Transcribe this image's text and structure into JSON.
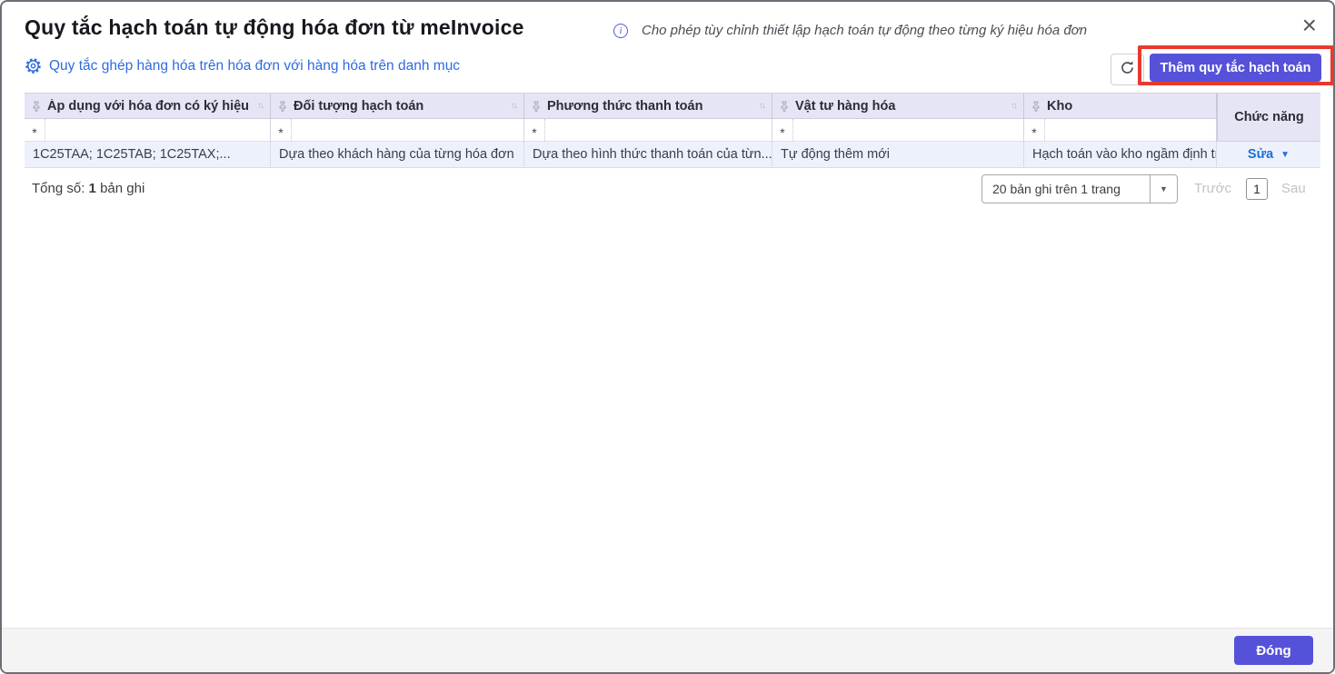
{
  "dialog": {
    "title": "Quy tắc hạch toán tự động hóa đơn từ meInvoice",
    "subtitle": "Cho phép tùy chỉnh thiết lập hạch toán tự động theo từng ký hiệu hóa đơn"
  },
  "toolbar": {
    "mapping_rule_link": "Quy tắc ghép hàng hóa trên hóa đơn với hàng hóa trên danh mục",
    "add_rule_button": "Thêm quy tắc hạch toán"
  },
  "table": {
    "columns": [
      {
        "label": "Áp dụng với hóa đơn có ký hiệu"
      },
      {
        "label": "Đối tượng hạch toán"
      },
      {
        "label": "Phương thức thanh toán"
      },
      {
        "label": "Vật tư hàng hóa"
      },
      {
        "label": "Kho"
      }
    ],
    "actions_column": "Chức năng",
    "filter_value": "*",
    "rows": [
      {
        "cells": [
          "1C25TAA; 1C25TAB; 1C25TAX;...",
          "Dựa theo khách hàng của từng hóa đơn",
          "Dựa theo hình thức thanh toán của từn...",
          "Tự động thêm mới",
          "Hạch toán vào kho ngầm định trê"
        ],
        "action": "Sửa"
      }
    ]
  },
  "summary": {
    "label": "Tổng số:",
    "count": "1",
    "unit": "bản ghi"
  },
  "pagination": {
    "page_size": "20 bản ghi trên 1 trang",
    "prev": "Trước",
    "current_page": "1",
    "next": "Sau"
  },
  "footer": {
    "close_button": "Đóng"
  },
  "icons": {
    "close": "×",
    "info": "i",
    "sort": "↑↓",
    "dropdown": "▼",
    "action_caret": "▼"
  },
  "colors": {
    "primary": "#5552d9",
    "link": "#2e6be0",
    "action_link": "#1a70d9",
    "annotation_red": "#e8392f",
    "header_bg": "#e5e5f6",
    "row_bg": "#edf1fb"
  }
}
